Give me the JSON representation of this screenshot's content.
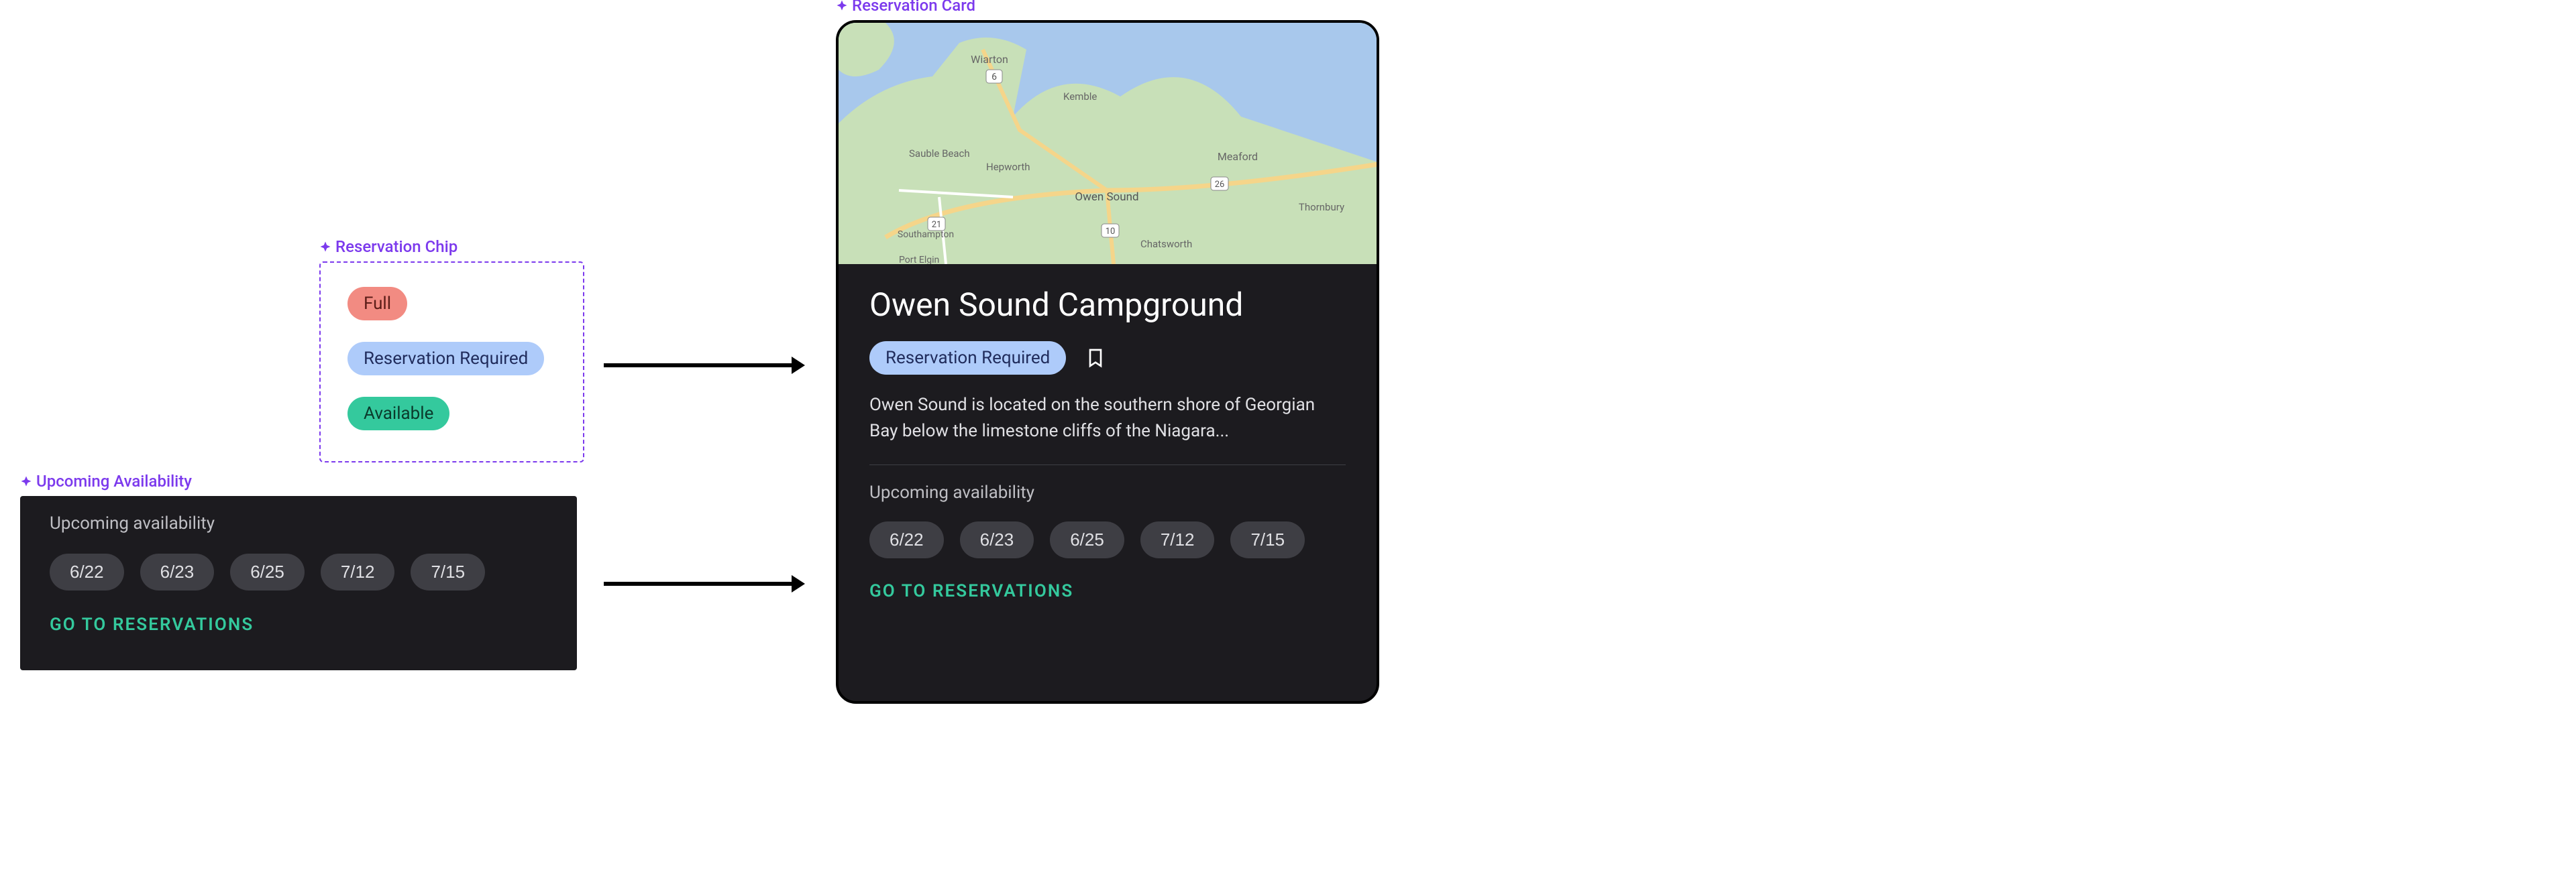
{
  "labels": {
    "reservation_chip": "Reservation Chip",
    "upcoming_availability": "Upcoming Availability",
    "reservation_card": "Reservation Card"
  },
  "chips": {
    "full": "Full",
    "reservation_required": "Reservation Required",
    "available": "Available"
  },
  "availability": {
    "title": "Upcoming availability",
    "dates": [
      "6/22",
      "6/23",
      "6/25",
      "7/12",
      "7/15"
    ],
    "cta": "Go to Reservations"
  },
  "card": {
    "title": "Owen Sound Campground",
    "status": "Reservation Required",
    "description": "Owen Sound is located on the southern shore of Georgian Bay below the limestone cliffs of the Niagara...",
    "availability_title": "Upcoming availability",
    "dates": [
      "6/22",
      "6/23",
      "6/25",
      "7/12",
      "7/15"
    ],
    "cta": "Go to Reservations",
    "map_places": {
      "wiarton": "Wiarton",
      "kemble": "Kemble",
      "sauble": "Sauble Beach",
      "hepworth": "Hepworth",
      "owensound": "Owen Sound",
      "meaford": "Meaford",
      "thornbury": "Thornbury",
      "southampton": "Southampton",
      "chatsworth": "Chatsworth",
      "portelgin": "Port Elgin",
      "highway6": "6",
      "highway10": "10",
      "highway26": "26",
      "highway21": "21"
    }
  }
}
